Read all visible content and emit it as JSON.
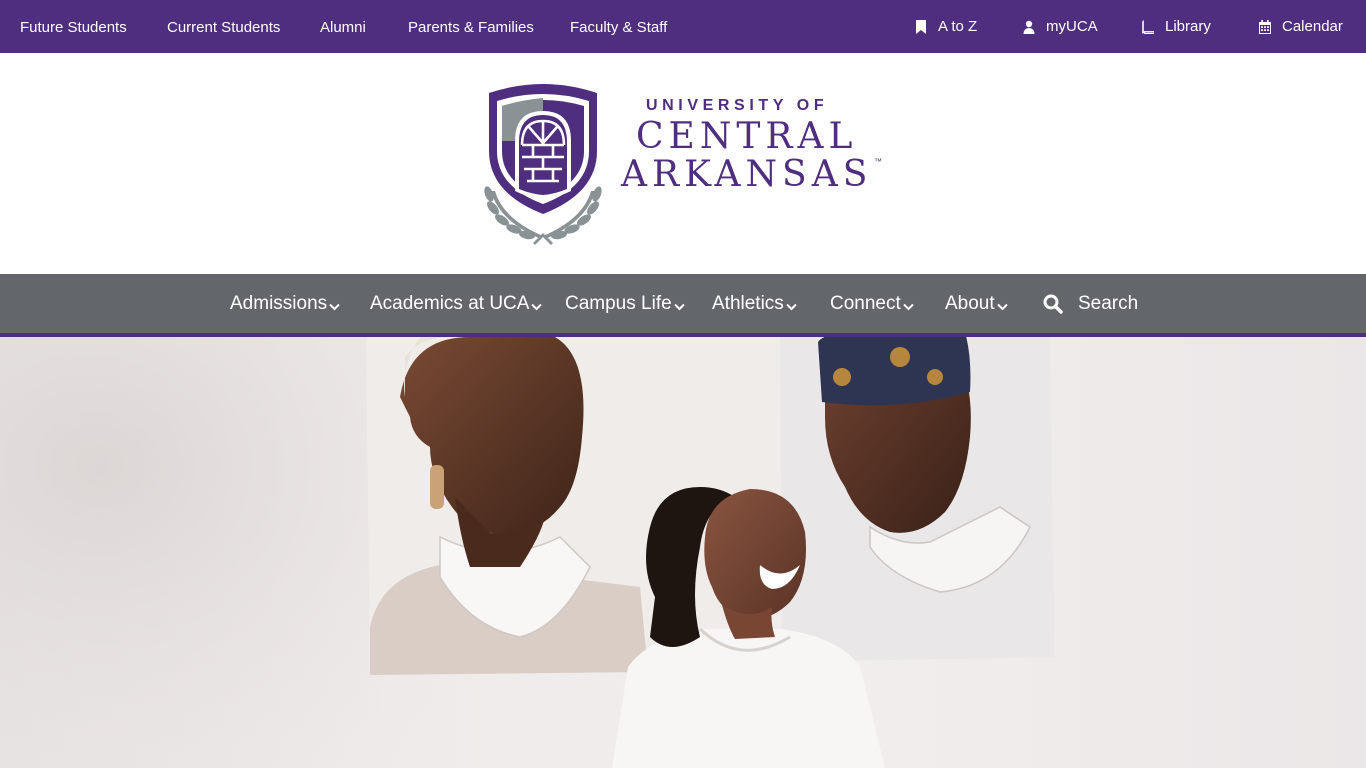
{
  "top_nav": {
    "left_links": [
      "Future Students",
      "Current Students",
      "Alumni",
      "Parents & Families",
      "Faculty & Staff"
    ],
    "right_links": [
      {
        "label": "A to Z",
        "icon": "bookmark-icon"
      },
      {
        "label": "myUCA",
        "icon": "user-icon"
      },
      {
        "label": "Library",
        "icon": "book-icon"
      },
      {
        "label": "Calendar",
        "icon": "calendar-icon"
      }
    ]
  },
  "logo": {
    "line1": "UNIVERSITY OF",
    "line2": "CENTRAL",
    "line3": "ARKANSAS",
    "tm": "™"
  },
  "main_nav": {
    "items": [
      "Admissions",
      "Academics at UCA",
      "Campus Life",
      "Athletics",
      "Connect",
      "About"
    ],
    "search_label": "Search"
  },
  "colors": {
    "brand_purple": "#4f2d7f",
    "nav_gray": "#63676c",
    "laurel_gray": "#8a9296"
  }
}
